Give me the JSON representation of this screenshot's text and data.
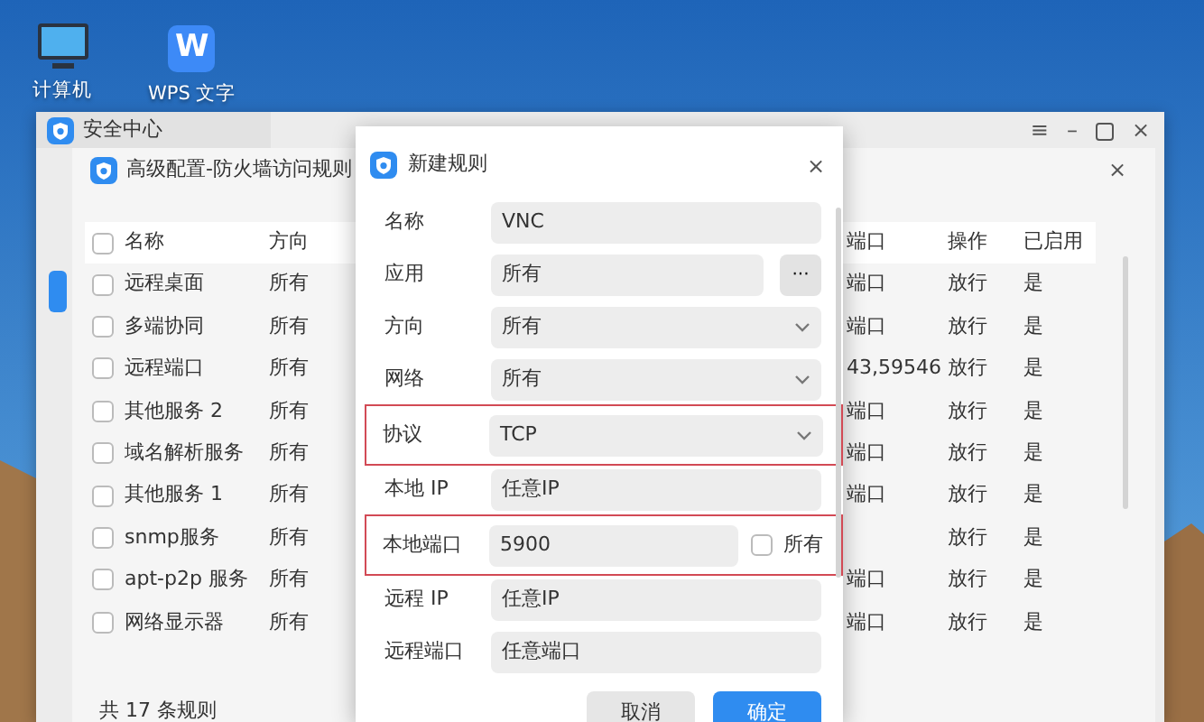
{
  "desktop_icons": [
    {
      "kind": "computer",
      "label": "计算机"
    },
    {
      "kind": "wps",
      "label": "WPS 文字",
      "logo_letter": "W"
    }
  ],
  "security_window": {
    "title": "安全中心",
    "menu_glyph": "≡",
    "minimize_glyph": "–",
    "close_glyph": "×"
  },
  "rules_window": {
    "title": "高级配置-防火墙访问规则",
    "close_glyph": "×",
    "table": {
      "columns": [
        "名称",
        "方向",
        "端口",
        "操作",
        "已启用"
      ],
      "header_checked": false,
      "rows": [
        {
          "checked": false,
          "name": "远程桌面",
          "direction": "所有",
          "port": "端口",
          "action": "放行",
          "enabled": "是"
        },
        {
          "checked": false,
          "name": "多端协同",
          "direction": "所有",
          "port": "端口",
          "action": "放行",
          "enabled": "是"
        },
        {
          "checked": false,
          "name": "远程端口",
          "direction": "所有",
          "port": "43,59546",
          "action": "放行",
          "enabled": "是"
        },
        {
          "checked": false,
          "name": "其他服务 2",
          "direction": "所有",
          "port": "端口",
          "action": "放行",
          "enabled": "是"
        },
        {
          "checked": false,
          "name": "域名解析服务",
          "direction": "所有",
          "port": "端口",
          "action": "放行",
          "enabled": "是"
        },
        {
          "checked": false,
          "name": "其他服务 1",
          "direction": "所有",
          "port": "端口",
          "action": "放行",
          "enabled": "是"
        },
        {
          "checked": false,
          "name": "snmp服务",
          "direction": "所有",
          "action": "放行",
          "enabled": "是"
        },
        {
          "checked": false,
          "name": "apt-p2p 服务",
          "direction": "所有",
          "port": "端口",
          "action": "放行",
          "enabled": "是"
        },
        {
          "checked": false,
          "name": "网络显示器",
          "direction": "所有",
          "port": "端口",
          "action": "放行",
          "enabled": "是"
        }
      ]
    },
    "footer": "共 17 条规则"
  },
  "dialog": {
    "title": "新建规则",
    "close_glyph": "×",
    "fields": [
      {
        "kind": "text",
        "label": "名称",
        "value": "VNC",
        "highlighted": false
      },
      {
        "kind": "picker",
        "label": "应用",
        "value": "所有",
        "more_button": "···",
        "highlighted": false
      },
      {
        "kind": "select",
        "label": "方向",
        "value": "所有",
        "highlighted": false
      },
      {
        "kind": "select",
        "label": "网络",
        "value": "所有",
        "highlighted": false
      },
      {
        "kind": "select",
        "label": "协议",
        "value": "TCP",
        "highlighted": true
      },
      {
        "kind": "text",
        "label": "本地 IP",
        "value": "任意IP",
        "highlighted": false
      },
      {
        "kind": "port",
        "label": "本地端口",
        "value": "5900",
        "all_label": "所有",
        "all_checked": false,
        "highlighted": true
      },
      {
        "kind": "text",
        "label": "远程 IP",
        "value": "任意IP",
        "highlighted": false
      },
      {
        "kind": "text",
        "label": "远程端口",
        "value": "任意端口",
        "highlighted": false
      }
    ],
    "buttons": [
      {
        "label": "取消",
        "primary": false
      },
      {
        "label": "确定",
        "primary": true
      }
    ]
  }
}
